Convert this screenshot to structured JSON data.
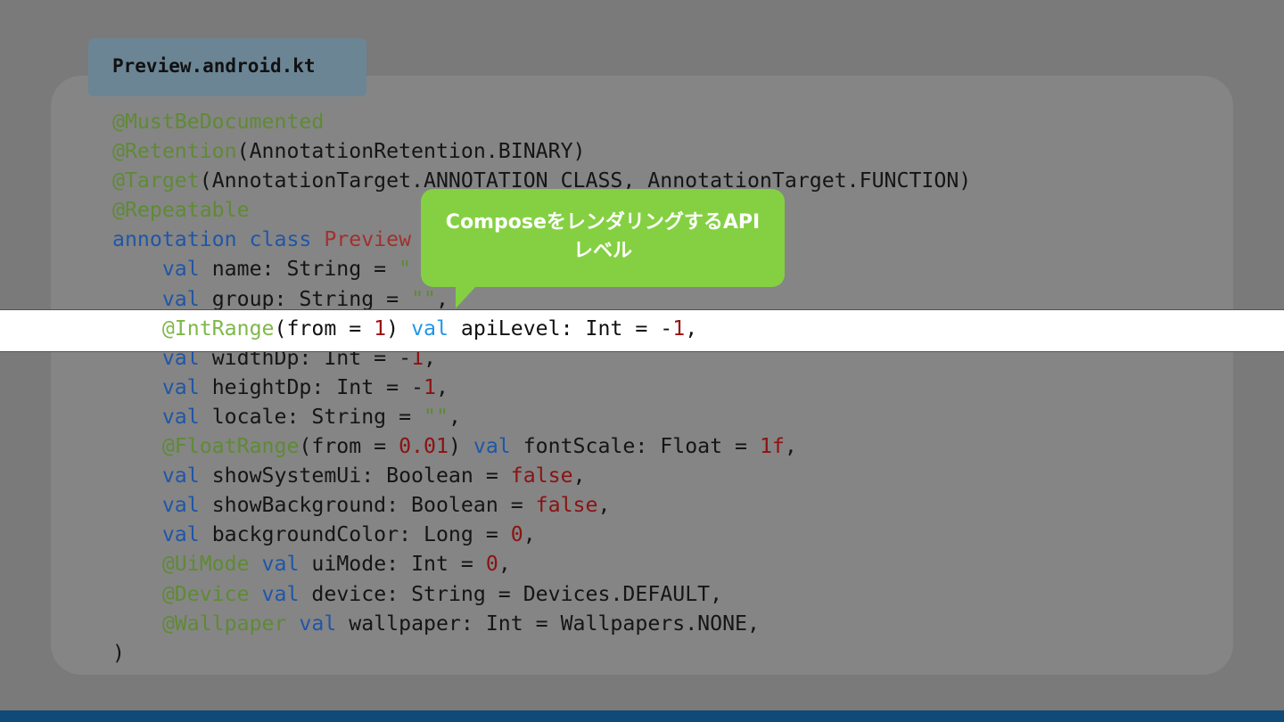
{
  "file_tab": {
    "name": "Preview.android.kt"
  },
  "callout": {
    "line1": "ComposeをレンダリングするAPI",
    "line2": "レベル"
  },
  "code": {
    "l1_ann": "@MustBeDocumented",
    "l2_ann": "@Retention",
    "l2_rest": "(AnnotationRetention.BINARY)",
    "l3_ann": "@Target",
    "l3_rest": "(AnnotationTarget.ANNOTATION_CLASS, AnnotationTarget.FUNCTION)",
    "l4_ann": "@Repeatable",
    "l5_kw": "annotation class",
    "l5_cls": "Preview",
    "l6_kw": "val",
    "l6_rest": " name: String = ",
    "l6_str": "\"",
    "l7_kw": "val",
    "l7_rest": " group: String = ",
    "l7_str": "\"\"",
    "l7_end": ",",
    "h_ann": "@IntRange",
    "h_a": "(from = ",
    "h_n1": "1",
    "h_b": ") ",
    "h_kw": "val",
    "h_c": " apiLevel: Int = -",
    "h_n2": "1",
    "h_d": ",",
    "l9_kw": "val",
    "l9_rest": " widthDp: Int = -",
    "l9_num": "1",
    "l9_end": ",",
    "l10_kw": "val",
    "l10_rest": " heightDp: Int = -",
    "l10_num": "1",
    "l10_end": ",",
    "l11_kw": "val",
    "l11_rest": " locale: String = ",
    "l11_str": "\"\"",
    "l11_end": ",",
    "l12_ann": "@FloatRange",
    "l12_a": "(from = ",
    "l12_n1": "0.01",
    "l12_b": ") ",
    "l12_kw": "val",
    "l12_c": " fontScale: Float = ",
    "l12_n2": "1f",
    "l12_end": ",",
    "l13_kw": "val",
    "l13_rest": " showSystemUi: Boolean = ",
    "l13_bool": "false",
    "l13_end": ",",
    "l14_kw": "val",
    "l14_rest": " showBackground: Boolean = ",
    "l14_bool": "false",
    "l14_end": ",",
    "l15_kw": "val",
    "l15_rest": " backgroundColor: Long = ",
    "l15_num": "0",
    "l15_end": ",",
    "l16_ann": "@UiMode",
    "l16_kw": "val",
    "l16_rest": " uiMode: Int = ",
    "l16_num": "0",
    "l16_end": ",",
    "l17_ann": "@Device",
    "l17_kw": "val",
    "l17_rest": " device: String = Devices.DEFAULT,",
    "l18_ann": "@Wallpaper",
    "l18_kw": "val",
    "l18_rest": " wallpaper: Int = Wallpapers.NONE,",
    "l19": ")"
  }
}
